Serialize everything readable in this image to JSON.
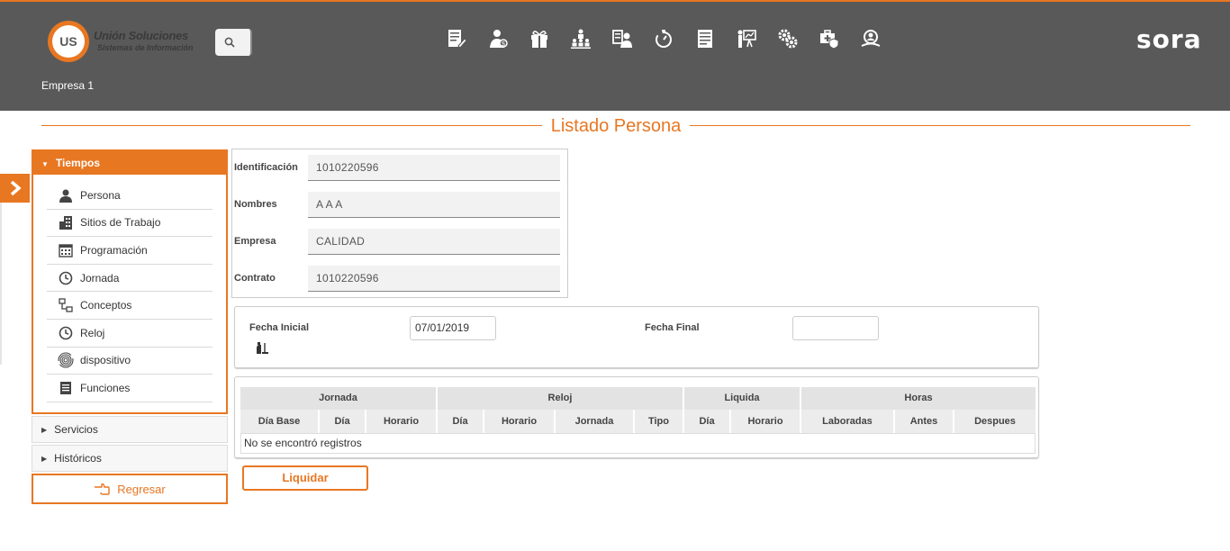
{
  "header": {
    "logo_badge": "US",
    "logo_title": "Unión Soluciones",
    "logo_subtitle": "Sistemas de Información",
    "brand": "sora",
    "company": "Empresa 1",
    "accent_color": "#e87722",
    "bg_color": "#595959",
    "module_icons": [
      "document-edit-icon",
      "person-money-icon",
      "gift-icon",
      "org-hierarchy-icon",
      "id-card-person-icon",
      "timer-icon",
      "report-list-icon",
      "presentation-person-icon",
      "gears-icon",
      "medical-shield-icon",
      "user-search-icon"
    ]
  },
  "page": {
    "title": "Listado Persona"
  },
  "sidebar": {
    "section_title": "Tiempos",
    "items": [
      {
        "label": "Persona",
        "icon": "person-icon"
      },
      {
        "label": "Sitios de Trabajo",
        "icon": "buildings-icon"
      },
      {
        "label": "Programación",
        "icon": "calendar-icon"
      },
      {
        "label": "Jornada",
        "icon": "clock-icon"
      },
      {
        "label": "Conceptos",
        "icon": "concepts-icon"
      },
      {
        "label": "Reloj",
        "icon": "clock-icon"
      },
      {
        "label": "dispositivo",
        "icon": "fingerprint-icon"
      },
      {
        "label": "Funciones",
        "icon": "document-icon"
      }
    ],
    "collapsed_sections": [
      "Servicios",
      "Históricos"
    ],
    "back_label": "Regresar"
  },
  "person": {
    "fields": [
      {
        "label": "Identificación",
        "value": "1010220596"
      },
      {
        "label": "Nombres",
        "value": "A A A"
      },
      {
        "label": "Empresa",
        "value": "CALIDAD"
      },
      {
        "label": "Contrato",
        "value": "1010220596"
      }
    ]
  },
  "filter": {
    "start_label": "Fecha Inicial",
    "start_value": "07/01/2019",
    "end_label": "Fecha Final",
    "end_value": ""
  },
  "table": {
    "groups": [
      "Jornada",
      "Reloj",
      "Liquida",
      "Horas"
    ],
    "columns": [
      "Día Base",
      "Día",
      "Horario",
      "Día",
      "Horario",
      "Jornada",
      "Tipo",
      "Día",
      "Horario",
      "Laboradas",
      "Antes",
      "Despues"
    ],
    "empty_message": "No se encontró registros"
  },
  "actions": {
    "liquidar_label": "Liquidar"
  }
}
